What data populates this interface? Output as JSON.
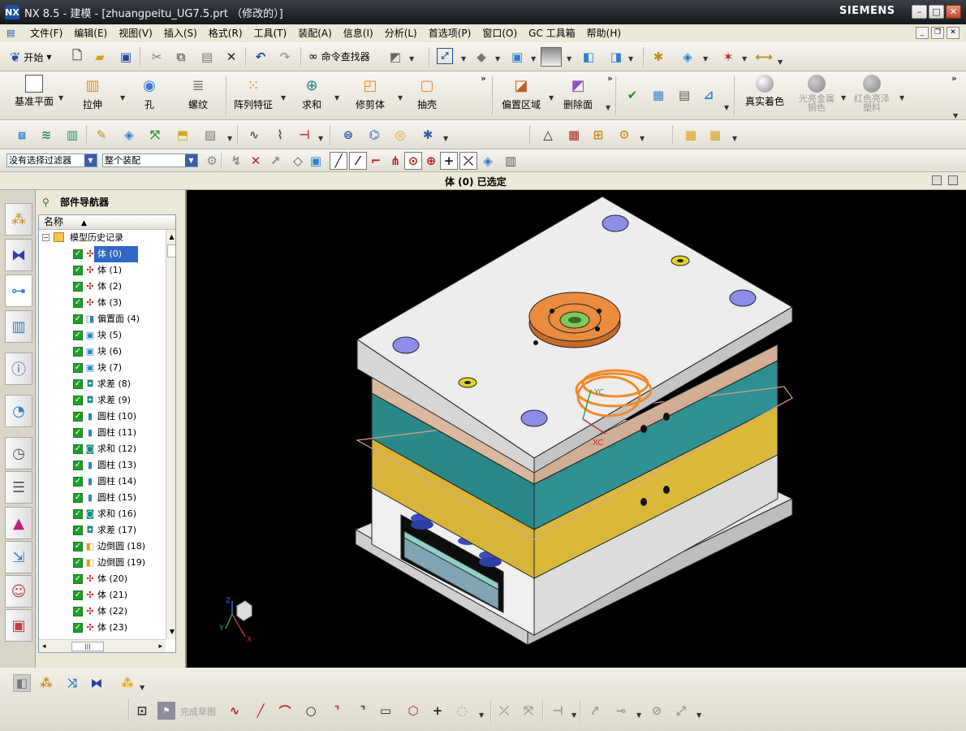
{
  "title_bar": {
    "app_title": "NX 8.5 - 建模 - [zhuangpeitu_UG7.5.prt （修改的）]",
    "brand": "SIEMENS",
    "logo": "NX"
  },
  "menu": {
    "items": [
      "文件(F)",
      "编辑(E)",
      "视图(V)",
      "插入(S)",
      "格式(R)",
      "工具(T)",
      "装配(A)",
      "信息(I)",
      "分析(L)",
      "首选项(P)",
      "窗口(O)",
      "GC 工具箱",
      "帮助(H)"
    ]
  },
  "toolbar_standard": {
    "start_label": "开始",
    "command_finder_label": "命令查找器"
  },
  "toolbar_features": {
    "buttons": [
      {
        "label": "基准平面",
        "icon": "datum-plane-icon"
      },
      {
        "label": "拉伸",
        "icon": "extrude-icon"
      },
      {
        "label": "孔",
        "icon": "hole-icon"
      },
      {
        "label": "螺纹",
        "icon": "thread-icon"
      },
      {
        "label": "阵列特征",
        "icon": "pattern-feature-icon"
      },
      {
        "label": "求和",
        "icon": "unite-icon"
      },
      {
        "label": "修剪体",
        "icon": "trim-body-icon"
      },
      {
        "label": "抽壳",
        "icon": "shell-icon"
      },
      {
        "label": "偏置区域",
        "icon": "offset-region-icon"
      },
      {
        "label": "删除面",
        "icon": "delete-face-icon"
      },
      {
        "label": "真实着色",
        "icon": "true-shading-icon"
      },
      {
        "label": "光亮金属\n铜色",
        "icon": "shiny-metal-copper-icon"
      },
      {
        "label": "红色亮泽\n塑料",
        "icon": "red-glossy-plastic-icon"
      }
    ]
  },
  "selection_bar": {
    "filter_value": "没有选择过滤器",
    "scope_value": "整个装配"
  },
  "status": {
    "cue_text": "体 (0) 已选定"
  },
  "navigator": {
    "title": "部件导航器",
    "column_name": "名称",
    "root_label": "模型历史记录",
    "items": [
      {
        "label": "体 (0)",
        "icon": "body-icon",
        "selected": true
      },
      {
        "label": "体 (1)",
        "icon": "body-icon"
      },
      {
        "label": "体 (2)",
        "icon": "body-icon"
      },
      {
        "label": "体 (3)",
        "icon": "body-icon"
      },
      {
        "label": "偏置面 (4)",
        "icon": "offset-face-icon"
      },
      {
        "label": "块 (5)",
        "icon": "block-icon"
      },
      {
        "label": "块 (6)",
        "icon": "block-icon"
      },
      {
        "label": "块 (7)",
        "icon": "block-icon"
      },
      {
        "label": "求差 (8)",
        "icon": "subtract-icon"
      },
      {
        "label": "求差 (9)",
        "icon": "subtract-icon"
      },
      {
        "label": "圆柱 (10)",
        "icon": "cylinder-icon"
      },
      {
        "label": "圆柱 (11)",
        "icon": "cylinder-icon"
      },
      {
        "label": "求和 (12)",
        "icon": "unite-icon"
      },
      {
        "label": "圆柱 (13)",
        "icon": "cylinder-icon"
      },
      {
        "label": "圆柱 (14)",
        "icon": "cylinder-icon"
      },
      {
        "label": "圆柱 (15)",
        "icon": "cylinder-icon"
      },
      {
        "label": "求和 (16)",
        "icon": "unite-icon"
      },
      {
        "label": "求差 (17)",
        "icon": "subtract-icon"
      },
      {
        "label": "边倒圆 (18)",
        "icon": "edge-blend-icon"
      },
      {
        "label": "边倒圆 (19)",
        "icon": "edge-blend-icon"
      },
      {
        "label": "体 (20)",
        "icon": "body-icon"
      },
      {
        "label": "体 (21)",
        "icon": "body-icon"
      },
      {
        "label": "体 (22)",
        "icon": "body-icon"
      },
      {
        "label": "体 (23)",
        "icon": "body-icon"
      }
    ]
  },
  "viewport": {
    "background": "#000000",
    "triad_labels": {
      "z": "Z",
      "y": "Y",
      "x": "X"
    },
    "wcs_labels": {
      "yc": "YC",
      "xc": "XC"
    }
  },
  "sketch_toolbar": {
    "finish_sketch_label": "完成草图"
  },
  "colors": {
    "plate_top": "#e8e8e8",
    "cavity_teal": "#2a8a8a",
    "core_yellow": "#d9b93a",
    "locating_ring": "#e9883c",
    "bolt_blue": "#8c8de6",
    "selection_blue": "#3167c5"
  }
}
